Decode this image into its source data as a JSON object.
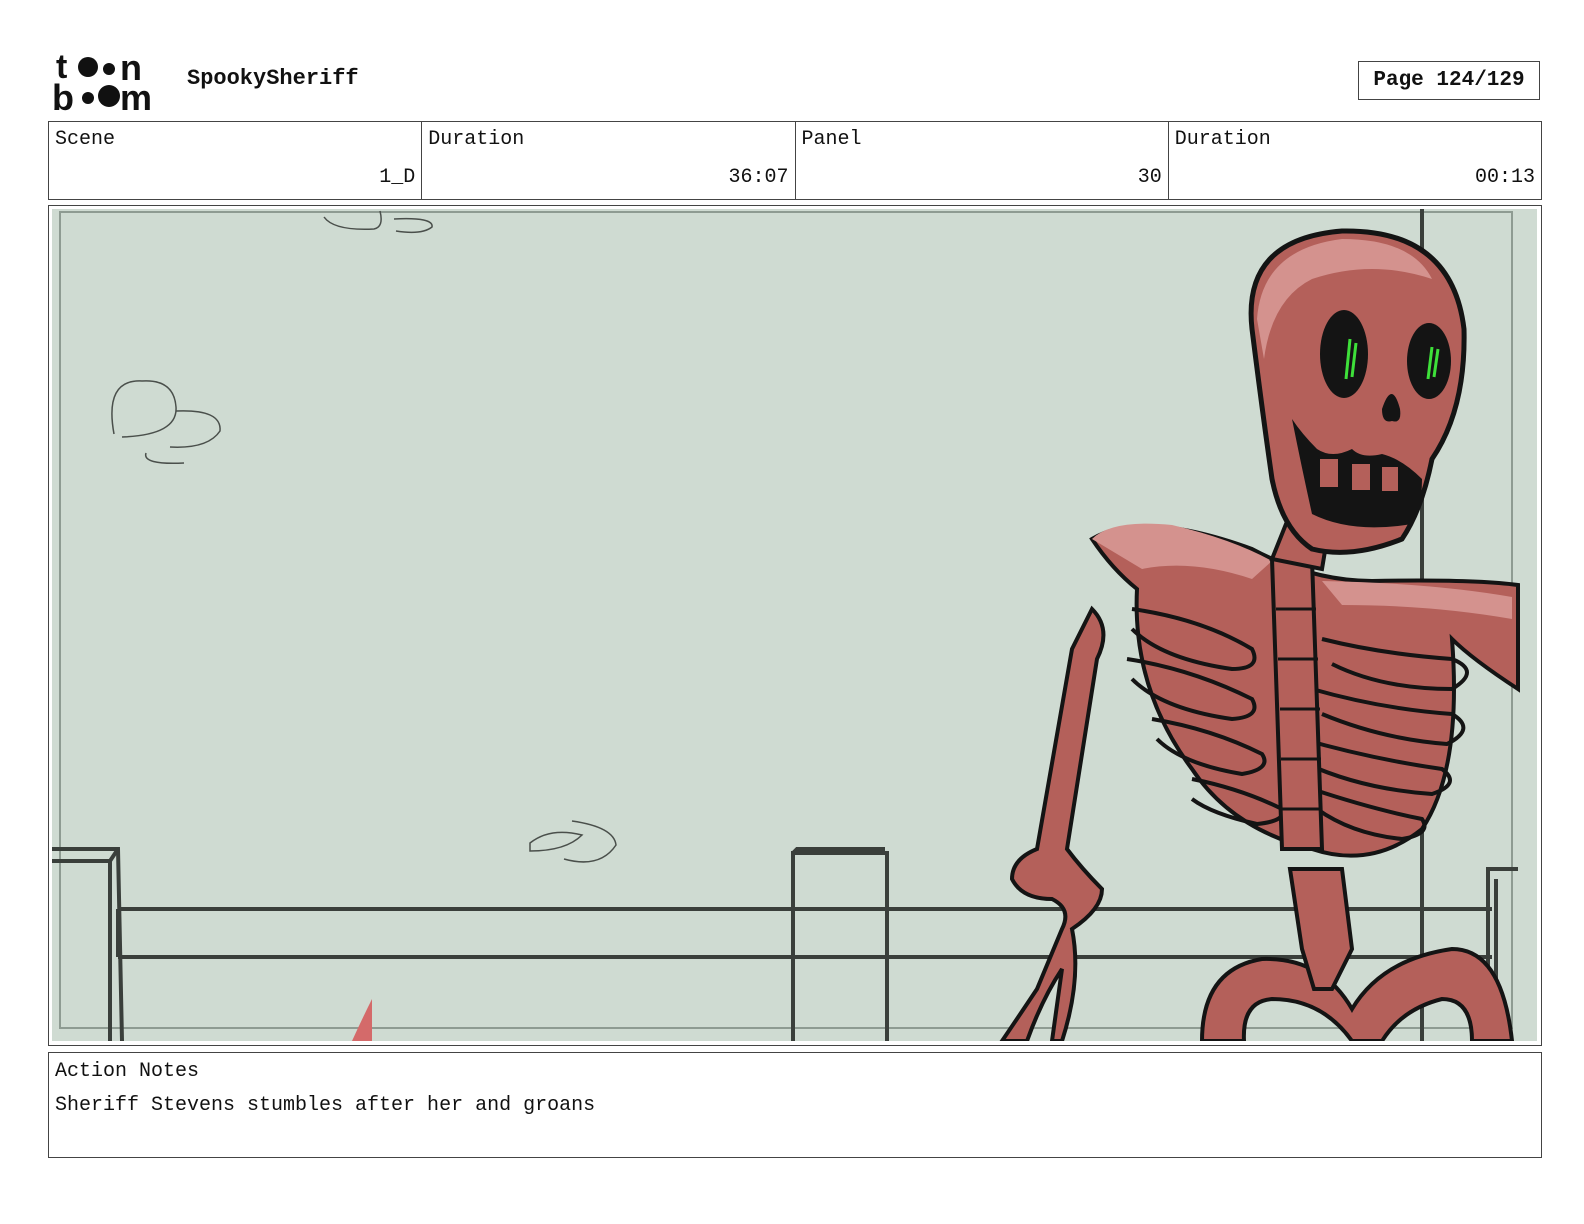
{
  "header": {
    "logo_icon": "toonboom-logo",
    "logo_text_top": "toon",
    "logo_text_bottom": "boom",
    "project_title": "SpookySheriff",
    "page_label": "Page 124/129"
  },
  "info": {
    "scene_label": "Scene",
    "scene_value": "1_D",
    "scene_duration_label": "Duration",
    "scene_duration_value": "36:07",
    "panel_label": "Panel",
    "panel_value": "30",
    "panel_duration_label": "Duration",
    "panel_duration_value": "00:13"
  },
  "panel_image": {
    "description_icon": "skeleton-sheriff-drawing",
    "colors": {
      "background": "#cfdbd2",
      "bone_dark": "#b4605a",
      "bone_light": "#d4928e",
      "outline": "#141414",
      "fence": "#3a3f3b",
      "eyes": "#3ee03a"
    }
  },
  "notes": {
    "label": "Action Notes",
    "text": "Sheriff Stevens stumbles after her and groans"
  }
}
